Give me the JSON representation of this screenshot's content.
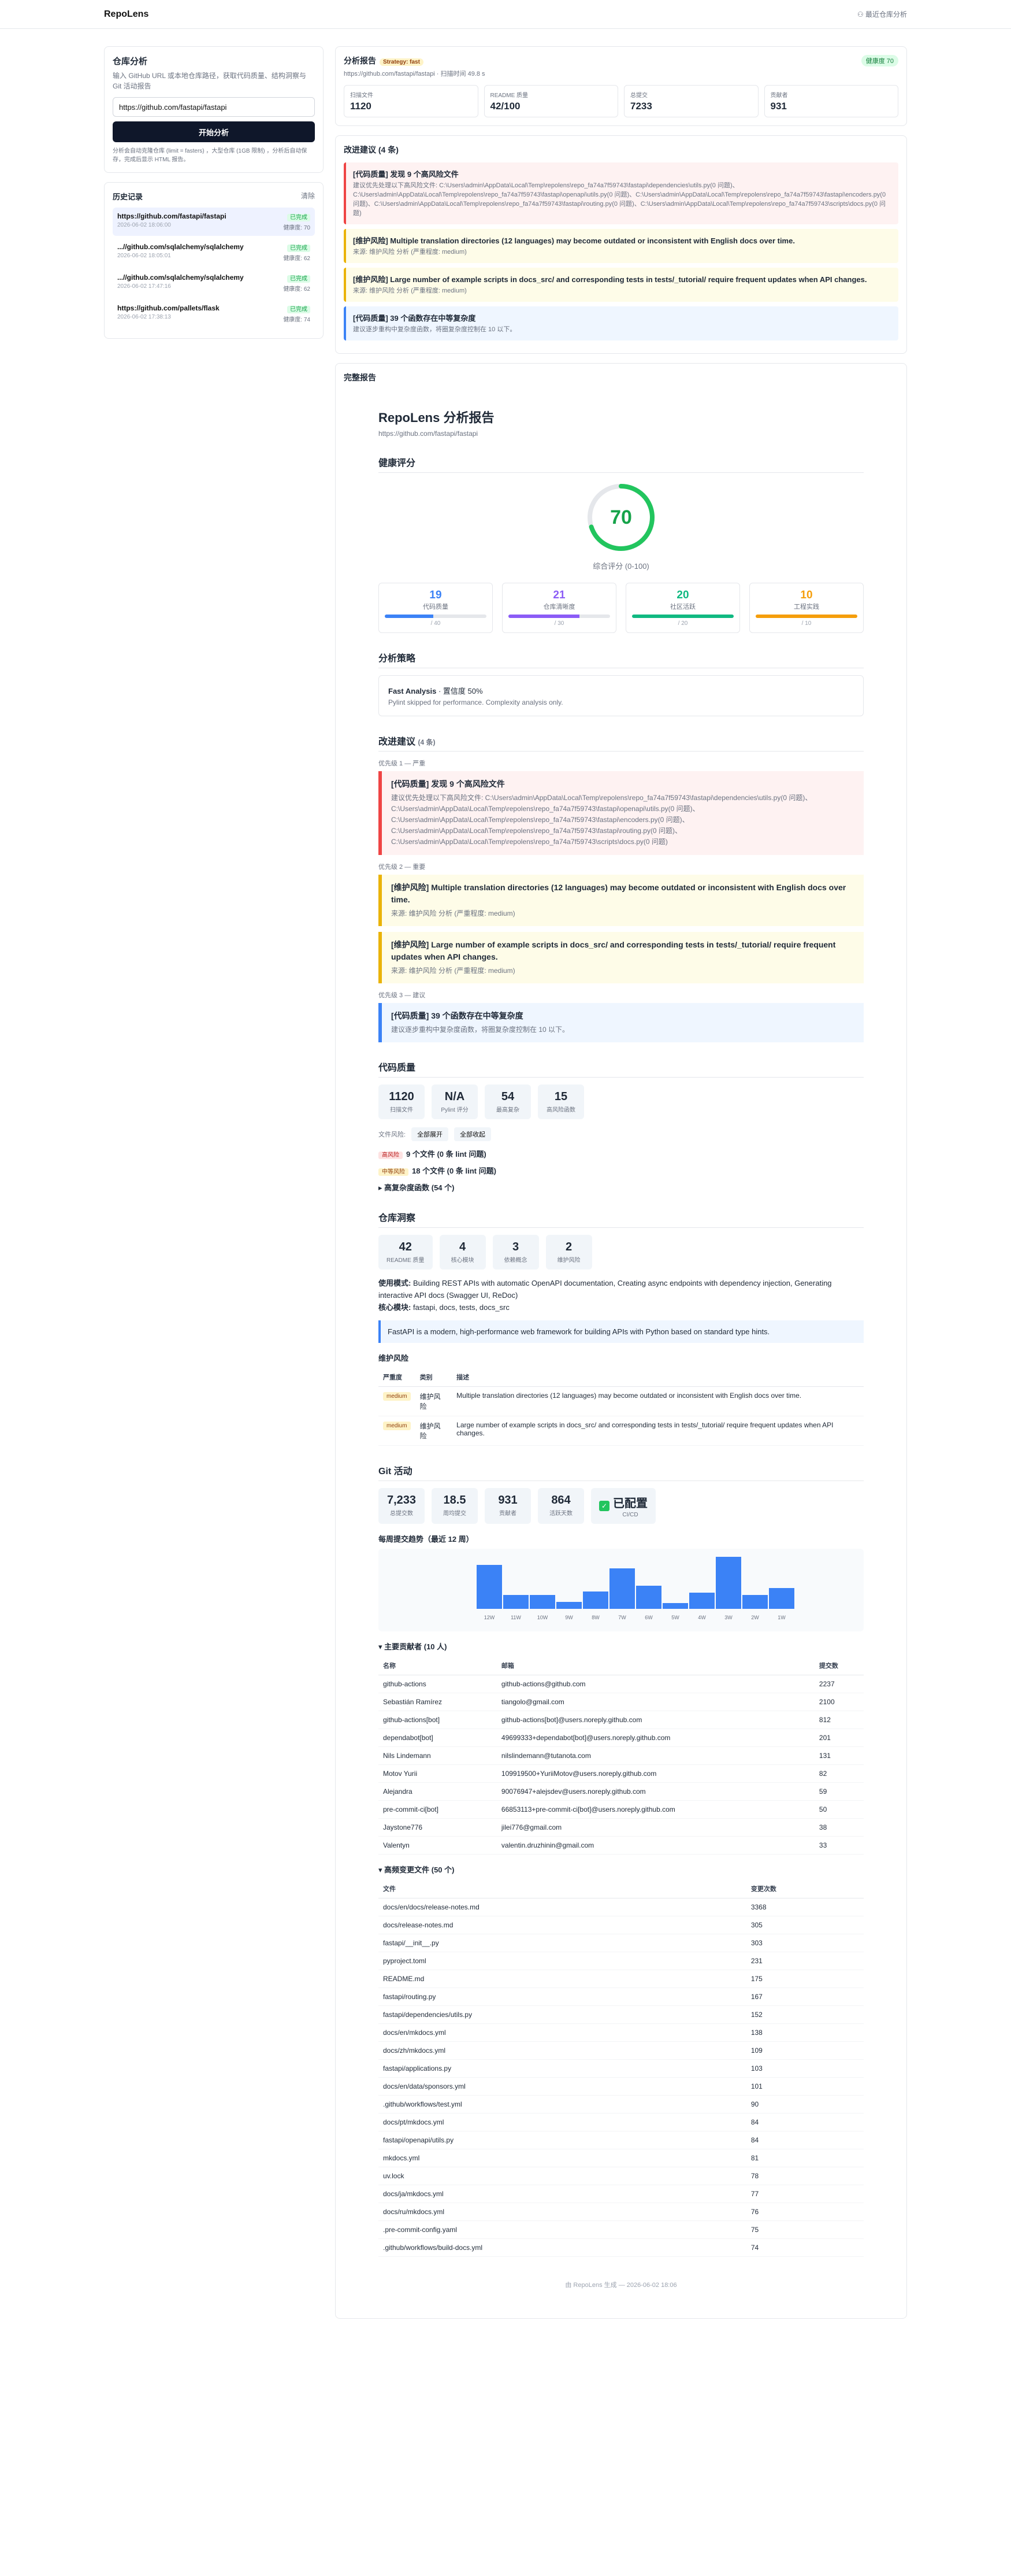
{
  "app": {
    "brand": "RepoLens",
    "toplink": "⚇ 最近仓库分析"
  },
  "left": {
    "title": "仓库分析",
    "desc": "输入 GitHub URL 或本地仓库路径，获取代码质量、结构洞察与 Git 活动报告",
    "input_value": "https://github.com/fastapi/fastapi",
    "button": "开始分析",
    "hint": "分析会自动克隆仓库 (limit = fasters) ，大型仓库 (1GB 限制) ，分析后自动保存，完成后显示 HTML 报告。",
    "history_title": "历史记录",
    "history_action": "清除",
    "history": [
      {
        "url": "https://github.com/fastapi/fastapi",
        "time": "2026-06-02 18:06:00",
        "status": "已完成",
        "score": "健康度: 70"
      },
      {
        "url": "...//github.com/sqlalchemy/sqlalchemy",
        "time": "2026-06-02 18:05:01",
        "status": "已完成",
        "score": "健康度: 62"
      },
      {
        "url": "...//github.com/sqlalchemy/sqlalchemy",
        "time": "2026-06-02 17:47:16",
        "status": "已完成",
        "score": "健康度: 62"
      },
      {
        "url": "https://github.com/pallets/flask",
        "time": "2026-06-02 17:38:13",
        "status": "已完成",
        "score": "健康度: 74"
      }
    ]
  },
  "report_head": {
    "title": "分析报告",
    "tag": "Strategy: fast",
    "sub": "https://github.com/fastapi/fastapi · 扫描时间 49.8 s",
    "status": "健康度 70",
    "stats": [
      {
        "l": "扫描文件",
        "v": "1120"
      },
      {
        "l": "README 质量",
        "v": "42/100"
      },
      {
        "l": "总提交",
        "v": "7233"
      },
      {
        "l": "贡献者",
        "v": "931"
      }
    ]
  },
  "recs_title": "改进建议 (4 条)",
  "recs": [
    {
      "c": "red",
      "t": "[代码质量] 发现 9 个高风险文件",
      "d": "建议优先处理以下高风险文件: C:\\Users\\admin\\AppData\\Local\\Temp\\repolens\\repo_fa74a7f59743\\fastapi\\dependencies\\utils.py(0 问题)、C:\\Users\\admin\\AppData\\Local\\Temp\\repolens\\repo_fa74a7f59743\\fastapi\\openapi\\utils.py(0 问题)、C:\\Users\\admin\\AppData\\Local\\Temp\\repolens\\repo_fa74a7f59743\\fastapi\\encoders.py(0 问题)、C:\\Users\\admin\\AppData\\Local\\Temp\\repolens\\repo_fa74a7f59743\\fastapi\\routing.py(0 问题)、C:\\Users\\admin\\AppData\\Local\\Temp\\repolens\\repo_fa74a7f59743\\scripts\\docs.py(0 问题)"
    },
    {
      "c": "yel",
      "t": "[维护风险] Multiple translation directories (12 languages) may become outdated or inconsistent with English docs over time.",
      "d": "来源: 维护风险 分析 (严重程度: medium)"
    },
    {
      "c": "yel",
      "t": "[维护风险] Large number of example scripts in docs_src/ and corresponding tests in tests/_tutorial/ require frequent updates when API changes.",
      "d": "来源: 维护风险 分析 (严重程度: medium)"
    },
    {
      "c": "blu",
      "t": "[代码质量] 39 个函数存在中等复杂度",
      "d": "建议逐步重构中复杂度函数，将圈复杂度控制在 10 以下。"
    }
  ],
  "full_title": "完整报告",
  "rep": {
    "title": "RepoLens 分析报告",
    "url": "https://github.com/fastapi/fastapi",
    "health_title": "健康评分",
    "score": 70,
    "score_label": "综合评分 (0-100)",
    "dims": [
      {
        "v": "19",
        "l": "代码质量",
        "m": "/ 40",
        "pct": 0.475,
        "color": "#3b82f6"
      },
      {
        "v": "21",
        "l": "仓库清晰度",
        "m": "/ 30",
        "pct": 0.7,
        "color": "#8b5cf6"
      },
      {
        "v": "20",
        "l": "社区活跃",
        "m": "/ 20",
        "pct": 1,
        "color": "#10b981"
      },
      {
        "v": "10",
        "l": "工程实践",
        "m": "/ 10",
        "pct": 1,
        "color": "#f59e0b"
      }
    ],
    "strategy_title": "分析策略",
    "strategy_name": "Fast Analysis",
    "strategy_conf": " · 置信度 50%",
    "strategy_note": "Pylint skipped for performance. Complexity analysis only.",
    "recs_title": "改进建议",
    "recs_count": "(4 条)",
    "p1": "优先级 1 — 严重",
    "p2": "优先级 2 — 重要",
    "p3": "优先级 3 — 建议",
    "quality_title": "代码质量",
    "q_kpis": [
      {
        "v": "1120",
        "l": "扫描文件"
      },
      {
        "v": "N/A",
        "l": "Pylint 评分"
      },
      {
        "v": "54",
        "l": "最高复杂"
      },
      {
        "v": "15",
        "l": "高风险函数"
      }
    ],
    "q_filter_label": "文件风险:",
    "q_chip1": "全部展开",
    "q_chip2": "全部收起",
    "q_items": [
      {
        "pill": "高风险",
        "t": "9 个文件 (0 条 lint 问题)"
      },
      {
        "pill": "中等风险",
        "t": "18 个文件 (0 条 lint 问题)"
      },
      {
        "pill": "",
        "t": "▸ 高复杂度函数 (54 个)"
      }
    ],
    "insight_title": "仓库洞察",
    "i_kpis": [
      {
        "v": "42",
        "l": "README 质量"
      },
      {
        "v": "4",
        "l": "核心模块"
      },
      {
        "v": "3",
        "l": "依赖概念"
      },
      {
        "v": "2",
        "l": "维护风险"
      }
    ],
    "usage_label": "使用模式:",
    "usage": "Building REST APIs with automatic OpenAPI documentation, Creating async endpoints with dependency injection, Generating interactive API docs (Swagger UI, ReDoc)",
    "core_label": "核心模块:",
    "core": "fastapi, docs, tests, docs_src",
    "quote": "FastAPI is a modern, high-performance web framework for building APIs with Python based on standard type hints.",
    "risk_title": "维护风险",
    "risk_cols": [
      "严重度",
      "类别",
      "描述"
    ],
    "risks": [
      {
        "sev": "medium",
        "cat": "维护风险",
        "desc": "Multiple translation directories (12 languages) may become outdated or inconsistent with English docs over time."
      },
      {
        "sev": "medium",
        "cat": "维护风险",
        "desc": "Large number of example scripts in docs_src/ and corresponding tests in tests/_tutorial/ require frequent updates when API changes."
      }
    ],
    "git_title": "Git 活动",
    "g_kpis": [
      {
        "v": "7,233",
        "l": "总提交数"
      },
      {
        "v": "18.5",
        "l": "周均提交"
      },
      {
        "v": "931",
        "l": "贡献者"
      },
      {
        "v": "864",
        "l": "活跃天数"
      }
    ],
    "ci_value": "已配置",
    "ci_label": "CI/CD",
    "weekly_title": "每周提交趋势（最近 12 周）",
    "contrib_title": "▾ 主要贡献者 (10 人)",
    "contrib_cols": [
      "名称",
      "邮箱",
      "提交数"
    ],
    "contributors": [
      [
        "github-actions",
        "github-actions@github.com",
        "2237"
      ],
      [
        "Sebastián Ramírez",
        "tiangolo@gmail.com",
        "2100"
      ],
      [
        "github-actions[bot]",
        "github-actions[bot]@users.noreply.github.com",
        "812"
      ],
      [
        "dependabot[bot]",
        "49699333+dependabot[bot]@users.noreply.github.com",
        "201"
      ],
      [
        "Nils Lindemann",
        "nilslindemann@tutanota.com",
        "131"
      ],
      [
        "Motov Yurii",
        "109919500+YuriiMotov@users.noreply.github.com",
        "82"
      ],
      [
        "Alejandra",
        "90076947+alejsdev@users.noreply.github.com",
        "59"
      ],
      [
        "pre-commit-ci[bot]",
        "66853113+pre-commit-ci[bot]@users.noreply.github.com",
        "50"
      ],
      [
        "Jaystone776",
        "jilei776@gmail.com",
        "38"
      ],
      [
        "Valentyn",
        "valentin.druzhinin@gmail.com",
        "33"
      ]
    ],
    "files_title": "▾ 高频变更文件 (50 个)",
    "files_cols": [
      "文件",
      "变更次数"
    ],
    "files": [
      [
        "docs/en/docs/release-notes.md",
        "3368"
      ],
      [
        "docs/release-notes.md",
        "305"
      ],
      [
        "fastapi/__init__.py",
        "303"
      ],
      [
        "pyproject.toml",
        "231"
      ],
      [
        "README.md",
        "175"
      ],
      [
        "fastapi/routing.py",
        "167"
      ],
      [
        "fastapi/dependencies/utils.py",
        "152"
      ],
      [
        "docs/en/mkdocs.yml",
        "138"
      ],
      [
        "docs/zh/mkdocs.yml",
        "109"
      ],
      [
        "fastapi/applications.py",
        "103"
      ],
      [
        "docs/en/data/sponsors.yml",
        "101"
      ],
      [
        ".github/workflows/test.yml",
        "90"
      ],
      [
        "docs/pt/mkdocs.yml",
        "84"
      ],
      [
        "fastapi/openapi/utils.py",
        "84"
      ],
      [
        "mkdocs.yml",
        "81"
      ],
      [
        "uv.lock",
        "78"
      ],
      [
        "docs/ja/mkdocs.yml",
        "77"
      ],
      [
        "docs/ru/mkdocs.yml",
        "76"
      ],
      [
        ".pre-commit-config.yaml",
        "75"
      ],
      [
        ".github/workflows/build-docs.yml",
        "74"
      ]
    ],
    "footer": "由 RepoLens 生成 — 2026-06-02 18:06"
  },
  "chart_data": {
    "type": "bar",
    "title": "每周提交趋势（最近 12 周）",
    "categories": [
      "12W",
      "11W",
      "10W",
      "9W",
      "8W",
      "7W",
      "6W",
      "5W",
      "4W",
      "3W",
      "2W",
      "1W"
    ],
    "values": [
      38,
      12,
      12,
      6,
      15,
      35,
      20,
      5,
      14,
      45,
      12,
      18
    ],
    "color": "#3b82f6"
  }
}
